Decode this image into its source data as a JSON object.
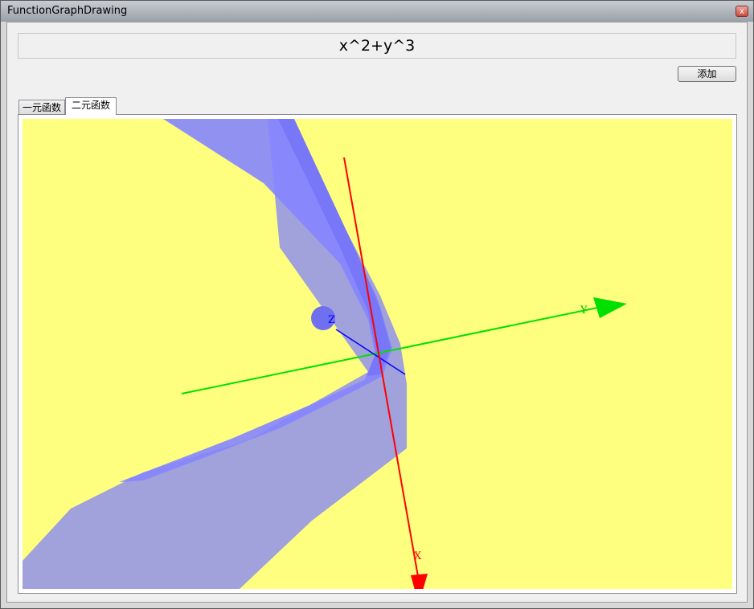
{
  "window": {
    "title": "FunctionGraphDrawing",
    "close_glyph": "x"
  },
  "formula": {
    "value": "x^2+y^3"
  },
  "toolbar": {
    "add_label": "添加"
  },
  "tabs": [
    {
      "label": "一元函数",
      "selected": false
    },
    {
      "label": "二元函数",
      "selected": true
    }
  ],
  "graph": {
    "background_color": "#ffff7f",
    "surface_color": "#8080ff",
    "axes": {
      "x_label": "X",
      "y_label": "Y",
      "z_label": "Z",
      "x_color": "#ff0000",
      "y_color": "#00e000",
      "z_color": "#0000ff"
    }
  }
}
